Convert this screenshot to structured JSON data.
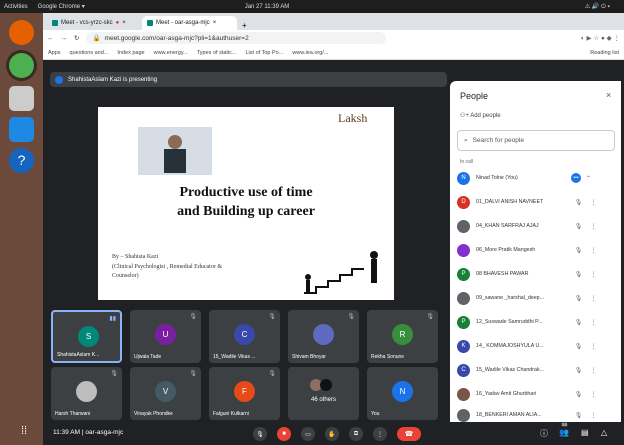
{
  "system": {
    "activities": "Activities",
    "app": "Google Chrome ▾",
    "clock": "Jan 27  11:39 AM",
    "tray": "⚠ 🔊 ⏻ ▾"
  },
  "browser": {
    "tabs": [
      {
        "label": "Meet - vcs-yrzc-skc"
      },
      {
        "label": "Meet - oar-asga-mjc"
      }
    ],
    "url": "meet.google.com/oar-asga-mjc?pli=1&authuser=2",
    "bookmarks": [
      "Apps",
      "questions and...",
      "Index page",
      "www.energy...",
      "Types of static...",
      "List of Top Po...",
      "www.iea.org/...",
      "Reading list"
    ]
  },
  "meet": {
    "presenting": "ShahistaAslam Kazi is presenting",
    "slide": {
      "logo": "Laksh",
      "title_line1": "Productive use of time",
      "title_line2": "and Building up career",
      "author_line1": "By – Shahista Kazi",
      "author_line2": "(Clinical Psychologist , Remedial Educator &",
      "author_line3": "Counselor)"
    },
    "people_panel": {
      "title": "People",
      "add_people": "Add people",
      "search_placeholder": "Search for people",
      "in_call": "In call",
      "participants": [
        {
          "name": "Ninad Tolne (You)",
          "initial": "N",
          "color": "#1a73e8"
        },
        {
          "name": "01_DALVI ANISH NAVNEET",
          "initial": "D",
          "color": "#d93025"
        },
        {
          "name": "04_KHAN SARFRAJ AJAJ",
          "initial": "",
          "color": "#5f6368"
        },
        {
          "name": "06_More Pratik Mangesh",
          "initial": "",
          "color": "#8430ce"
        },
        {
          "name": "08 BHAVESH PAWAR",
          "initial": "P",
          "color": "#188038"
        },
        {
          "name": "09_sawane _harshal_deep...",
          "initial": "",
          "color": "#5f6368"
        },
        {
          "name": "12_Suswade Samruddhi P...",
          "initial": "P",
          "color": "#188038"
        },
        {
          "name": "14_ KOMMAJOSHYULA U...",
          "initial": "K",
          "color": "#3949ab"
        },
        {
          "name": "15_Wadile Vikas Chandrak...",
          "initial": "C",
          "color": "#3949ab"
        },
        {
          "name": "16_Yadav Amit Ghurbhari",
          "initial": "",
          "color": "#795548"
        },
        {
          "name": "18_BENKERI AMAN ALIA...",
          "initial": "",
          "color": "#5f6368"
        }
      ]
    },
    "tiles": [
      {
        "name": "ShahistaAslam K...",
        "initial": "S",
        "color": "#00897b"
      },
      {
        "name": "Ujwala Tade",
        "initial": "U",
        "color": "#7b1fa2"
      },
      {
        "name": "15_Wadile Vikas ...",
        "initial": "C",
        "color": "#3949ab"
      },
      {
        "name": "Shivam Bhoyar",
        "initial": "",
        "color": "#5c6bc0"
      },
      {
        "name": "Rekha Sonune",
        "initial": "R",
        "color": "#388e3c"
      },
      {
        "name": "Harsh Tharwani",
        "initial": "",
        "color": "#bdbdbd"
      },
      {
        "name": "Vinayak Phondke",
        "initial": "V",
        "color": "#455a64"
      },
      {
        "name": "Falguni Kulkarni",
        "initial": "F",
        "color": "#e64a19"
      },
      {
        "name": "46 others",
        "initial": "",
        "color": "#5f6368"
      },
      {
        "name": "You",
        "initial": "N",
        "color": "#1a73e8"
      }
    ],
    "bottom": {
      "time": "11:39 AM",
      "sep": "|",
      "code": "oar-asga-mjc",
      "people_count": "56"
    }
  }
}
